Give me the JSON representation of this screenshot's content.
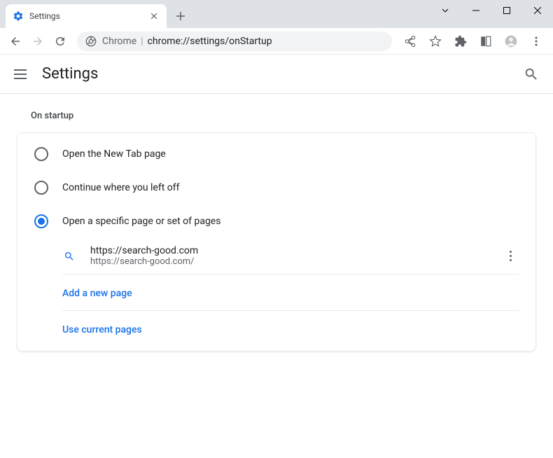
{
  "tab": {
    "title": "Settings"
  },
  "omnibox": {
    "prefix": "Chrome",
    "url": "chrome://settings/onStartup"
  },
  "header": {
    "title": "Settings"
  },
  "section": {
    "title": "On startup"
  },
  "options": {
    "new_tab": "Open the New Tab page",
    "continue": "Continue where you left off",
    "specific": "Open a specific page or set of pages"
  },
  "pages": [
    {
      "title": "https://search-good.com",
      "url": "https://search-good.com/"
    }
  ],
  "actions": {
    "add_page": "Add a new page",
    "use_current": "Use current pages"
  }
}
